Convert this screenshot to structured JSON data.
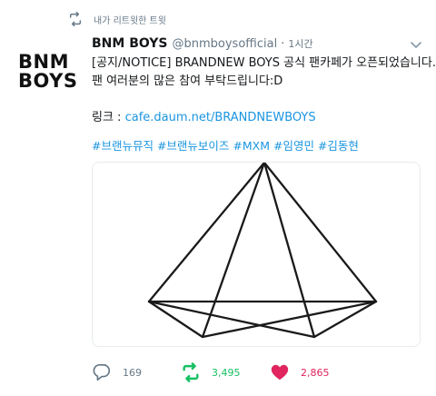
{
  "retweet_context": {
    "icon": "retweet-icon",
    "text": "내가 리트윗한 트윗"
  },
  "tweet": {
    "avatar_lines": [
      "BNM",
      "BOYS"
    ],
    "display_name": "BNM BOYS",
    "handle": "@bnmboysofficial",
    "separator": "·",
    "time": "1시간",
    "text_line1": "[공지/NOTICE] BRANDNEW BOYS 공식 팬카페가 오픈되었습니다.",
    "text_line2": "팬 여러분의 많은 참여 부탁드립니다:D",
    "link_label": "링크 : ",
    "link_url": "cafe.daum.net/BRANDNEWBOYS",
    "hashtags": "#브랜뉴뮤직 #브랜뉴보이즈 #MXM #임영민 #김동현"
  },
  "actions": {
    "reply_count": "169",
    "retweet_count": "3,495",
    "like_count": "2,865"
  },
  "colors": {
    "link": "#1b95e0",
    "retweet_active": "#17bf63",
    "like_active": "#e0245e",
    "muted": "#657786"
  }
}
